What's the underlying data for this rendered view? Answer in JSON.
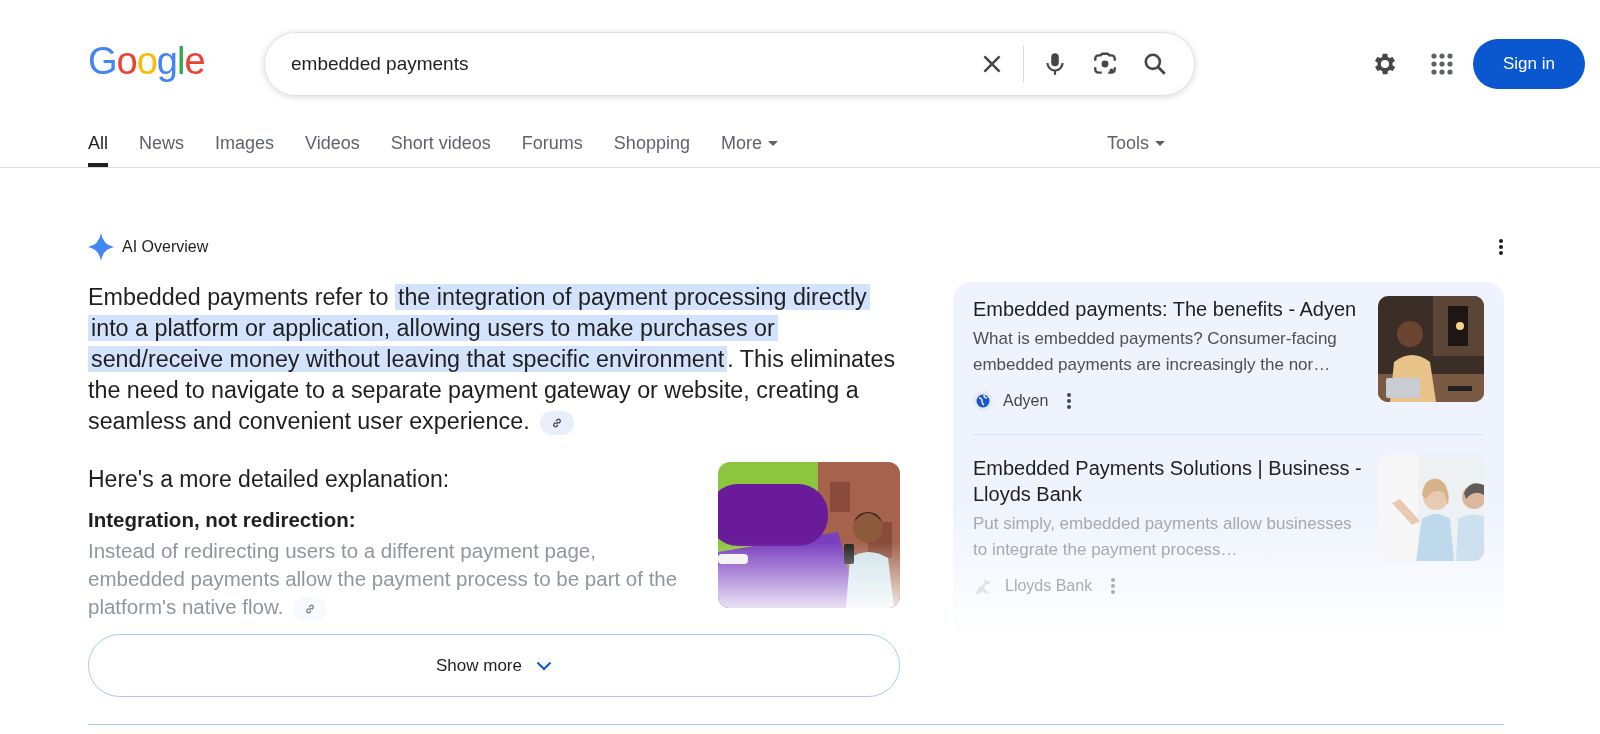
{
  "header": {
    "logo": "Google",
    "sign_in": "Sign in"
  },
  "search": {
    "value": "embedded payments"
  },
  "tabs": [
    {
      "label": "All",
      "selected": true
    },
    {
      "label": "News",
      "selected": false
    },
    {
      "label": "Images",
      "selected": false
    },
    {
      "label": "Videos",
      "selected": false
    },
    {
      "label": "Short videos",
      "selected": false
    },
    {
      "label": "Forums",
      "selected": false
    },
    {
      "label": "Shopping",
      "selected": false
    },
    {
      "label": "More",
      "selected": false,
      "kind": "menu"
    }
  ],
  "tools": {
    "label": "Tools"
  },
  "ai_overview": {
    "title": "AI Overview",
    "intro": {
      "before": "Embedded payments refer to ",
      "highlight": "the integration of payment processing directly into a platform or application, allowing users to make purchases or send/receive money without leaving that specific environment",
      "after": ". This eliminates the need to navigate to a separate payment gateway or website, creating a seamless and convenient user experience."
    },
    "lead": "Here's a more detailed explanation:",
    "points": [
      {
        "heading": "Integration, not redirection:",
        "body": "Instead of redirecting users to a different payment page, embedded payments allow the payment process to be part of the platform's native flow."
      }
    ],
    "show_more": "Show more",
    "sources": [
      {
        "title": "Embedded payments: The benefits - Adyen",
        "snippet": "What is embedded payments? Consumer-facing embedded payments are increasingly the nor…",
        "source": "Adyen"
      },
      {
        "title": "Embedded Payments Solutions | Business - Lloyds Bank",
        "snippet": "Put simply, embedded payments allow businesses to integrate the payment process…",
        "source": "Lloyds Bank"
      }
    ]
  }
}
